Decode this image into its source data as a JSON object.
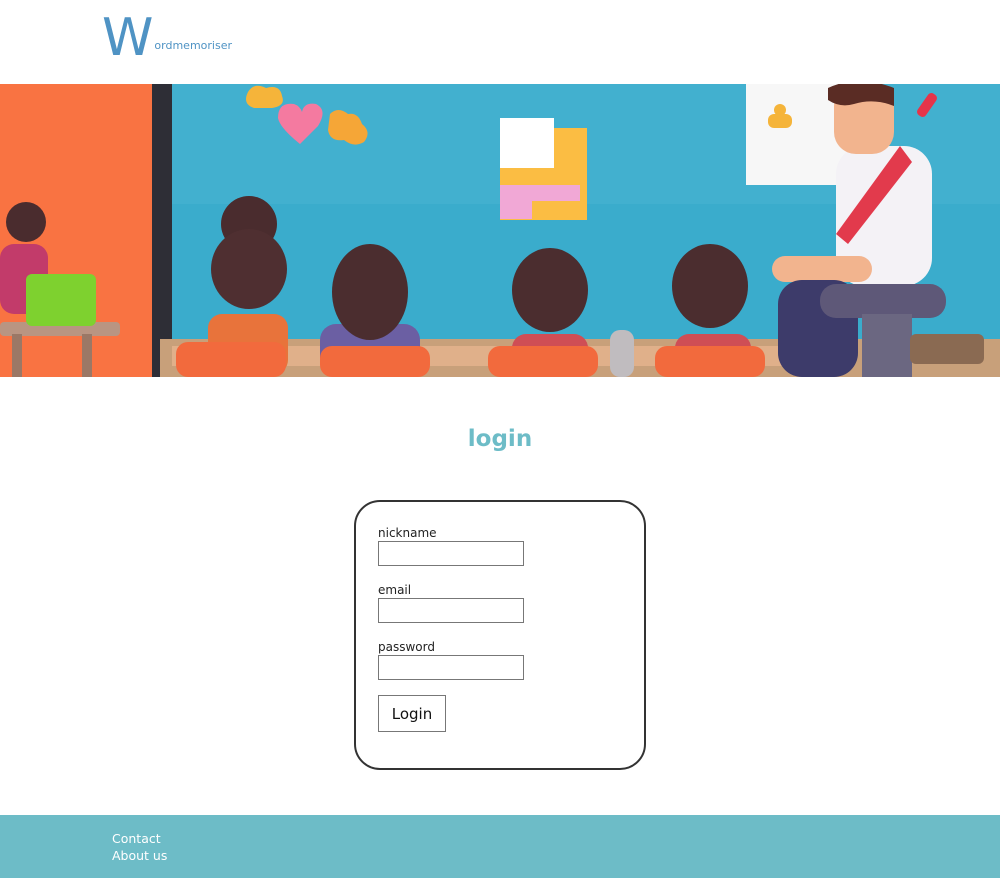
{
  "header": {
    "logo_letter": "W",
    "logo_rest": "ordmemoriser"
  },
  "hero": {
    "description_icon": "classroom-illustration"
  },
  "main": {
    "title": "login"
  },
  "form": {
    "nickname_label": "nickname",
    "nickname_value": "",
    "email_label": "email",
    "email_value": "",
    "password_label": "password",
    "password_value": "",
    "submit_label": "Login"
  },
  "footer": {
    "links": [
      "Contact",
      "About us"
    ]
  },
  "colors": {
    "brand": "#4f93c4",
    "accent": "#6dbcc7",
    "card_border": "#333333"
  }
}
